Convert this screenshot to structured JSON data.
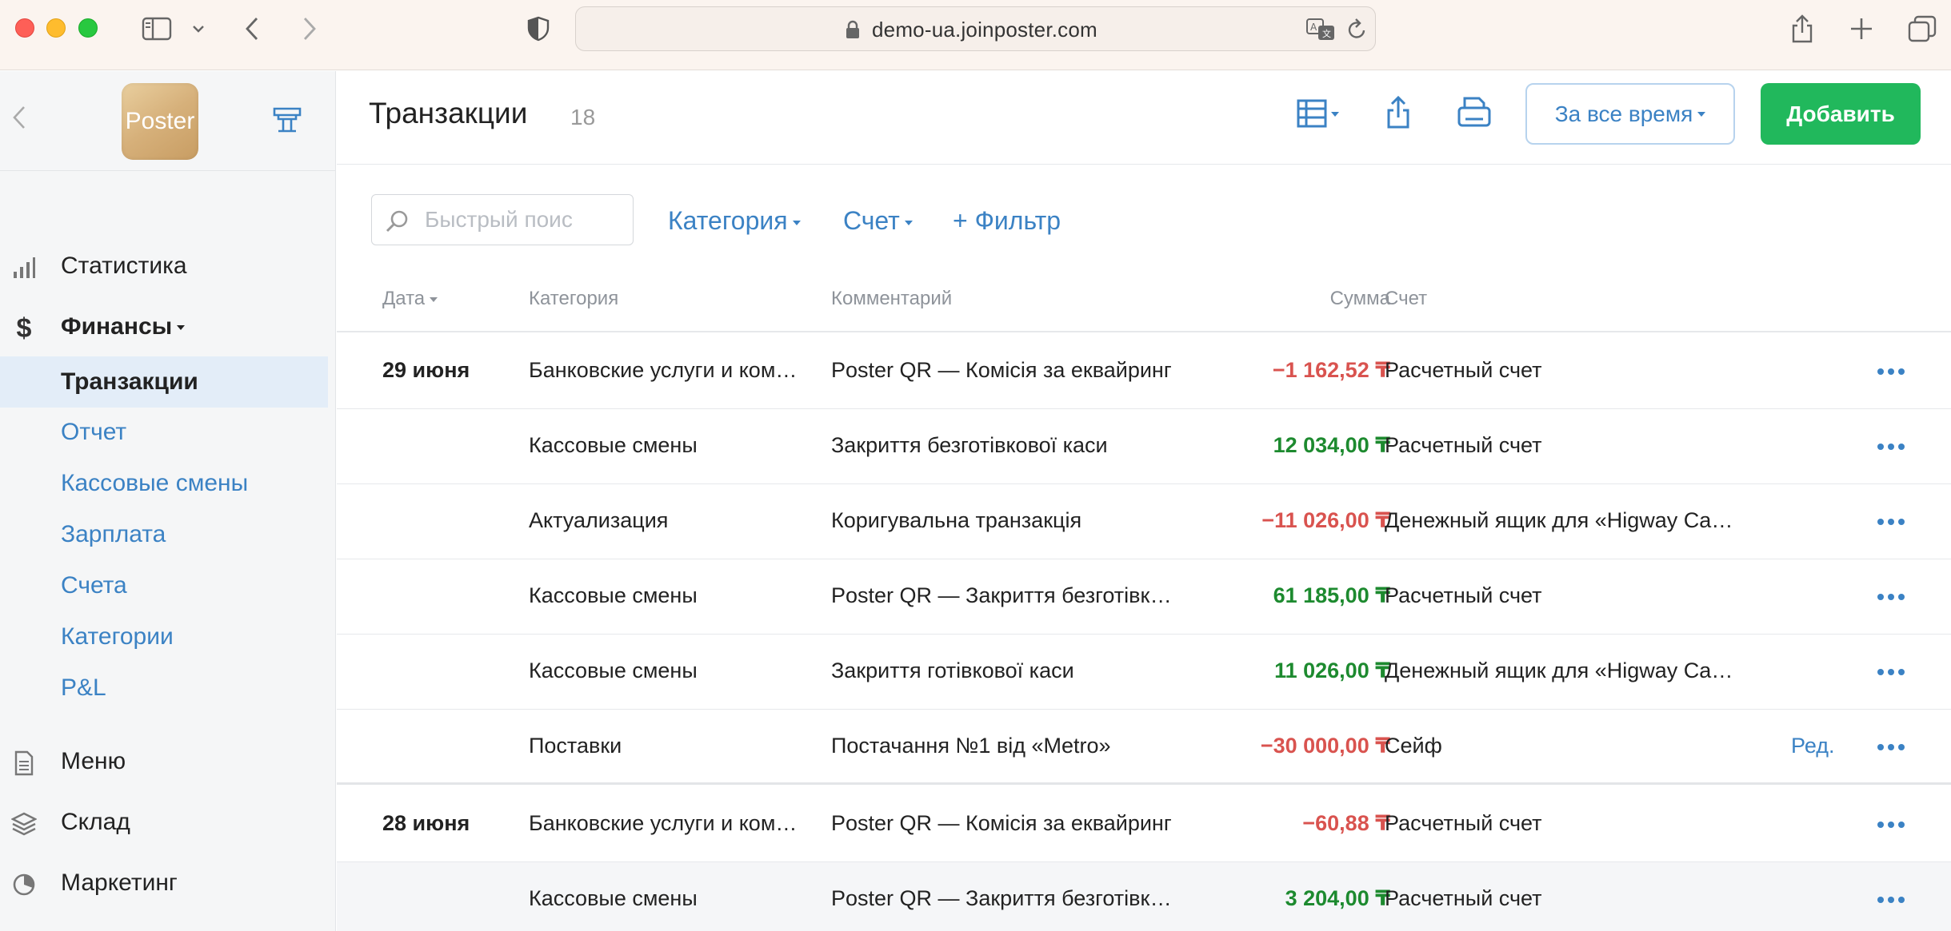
{
  "browser": {
    "url": "demo-ua.joinposter.com"
  },
  "sidebar": {
    "logo_text": "Poster",
    "nav": [
      {
        "label": "Статистика"
      },
      {
        "label": "Финансы"
      },
      {
        "label": "Меню"
      },
      {
        "label": "Склад"
      },
      {
        "label": "Маркетинг"
      }
    ],
    "finance_sub": [
      {
        "label": "Транзакции"
      },
      {
        "label": "Отчет"
      },
      {
        "label": "Кассовые смены"
      },
      {
        "label": "Зарплата"
      },
      {
        "label": "Счета"
      },
      {
        "label": "Категории"
      },
      {
        "label": "P&L"
      }
    ]
  },
  "header": {
    "title": "Транзакции",
    "count": "18",
    "period_label": "За все время",
    "add_label": "Добавить"
  },
  "filters": {
    "search_placeholder": "Быстрый поис",
    "category_label": "Категория",
    "account_label": "Счет",
    "add_filter_label": "+ Фильтр"
  },
  "table": {
    "columns": {
      "date": "Дата",
      "category": "Категория",
      "comment": "Комментарий",
      "sum": "Сумма",
      "account": "Счет"
    },
    "rows": [
      {
        "date": "29 июня",
        "category": "Банковские услуги и комиссии",
        "comment": "Poster QR — Комісія за еквайринг",
        "sum": "−1 162,52 ₸",
        "sign": "neg",
        "account": "Расчетный счет",
        "edit": ""
      },
      {
        "date": "",
        "category": "Кассовые смены",
        "comment": "Закриття безготівкової каси",
        "sum": "12 034,00 ₸",
        "sign": "pos",
        "account": "Расчетный счет",
        "edit": ""
      },
      {
        "date": "",
        "category": "Актуализация",
        "comment": "Коригувальна транзакція",
        "sum": "−11 026,00 ₸",
        "sign": "neg",
        "account": "Денежный ящик для «Higway Cafe»",
        "edit": ""
      },
      {
        "date": "",
        "category": "Кассовые смены",
        "comment": "Poster QR — Закриття безготівкової каси",
        "sum": "61 185,00 ₸",
        "sign": "pos",
        "account": "Расчетный счет",
        "edit": ""
      },
      {
        "date": "",
        "category": "Кассовые смены",
        "comment": "Закриття готівкової каси",
        "sum": "11 026,00 ₸",
        "sign": "pos",
        "account": "Денежный ящик для «Higway Cafe»",
        "edit": ""
      },
      {
        "date": "",
        "category": "Поставки",
        "comment": "Постачання №1 від «Metro»",
        "sum": "−30 000,00 ₸",
        "sign": "neg",
        "account": "Сейф",
        "edit": "Ред."
      },
      {
        "date": "28 июня",
        "category": "Банковские услуги и комиссии",
        "comment": "Poster QR — Комісія за еквайринг",
        "sum": "−60,88 ₸",
        "sign": "neg",
        "account": "Расчетный счет",
        "edit": ""
      },
      {
        "date": "",
        "category": "Кассовые смены",
        "comment": "Poster QR — Закриття безготівкової каси",
        "sum": "3 204,00 ₸",
        "sign": "pos",
        "account": "Расчетный счет",
        "edit": ""
      }
    ]
  }
}
